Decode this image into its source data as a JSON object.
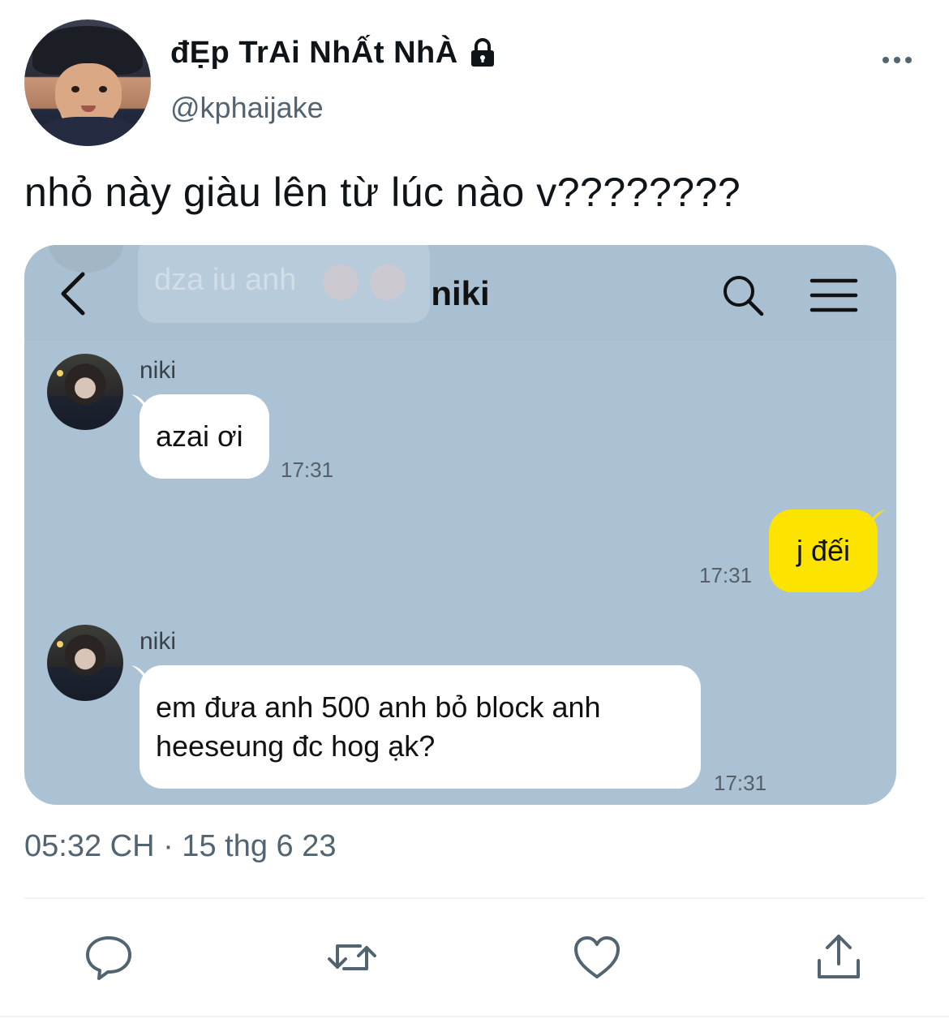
{
  "tweet": {
    "display_name": "đẸp TrAi NhẤt NhÀ",
    "handle": "@kphaijake",
    "text": "nhỏ này giàu lên từ lúc nào v????????",
    "timestamp": "05:32 CH · 15 thg 6 23",
    "icons": {
      "lock": "lock-icon",
      "more": "more-icon",
      "reply": "reply-icon",
      "retweet": "retweet-icon",
      "like": "heart-icon",
      "share": "share-icon"
    }
  },
  "chat": {
    "title": "niki",
    "ghost_text": "dza iu anh",
    "header_color": "#a9c0d3",
    "background_color": "#aac2d3",
    "outgoing_bubble_color": "#fce300",
    "messages": [
      {
        "sender": "niki",
        "text": "azai ơi",
        "time": "17:31",
        "direction": "in"
      },
      {
        "sender": "",
        "text": "j đếi",
        "time": "17:31",
        "direction": "out"
      },
      {
        "sender": "niki",
        "line1": "em đưa anh 500 anh bỏ block anh",
        "line2": "heeseung đc hog ạk?",
        "time": "17:31",
        "direction": "in"
      }
    ]
  }
}
